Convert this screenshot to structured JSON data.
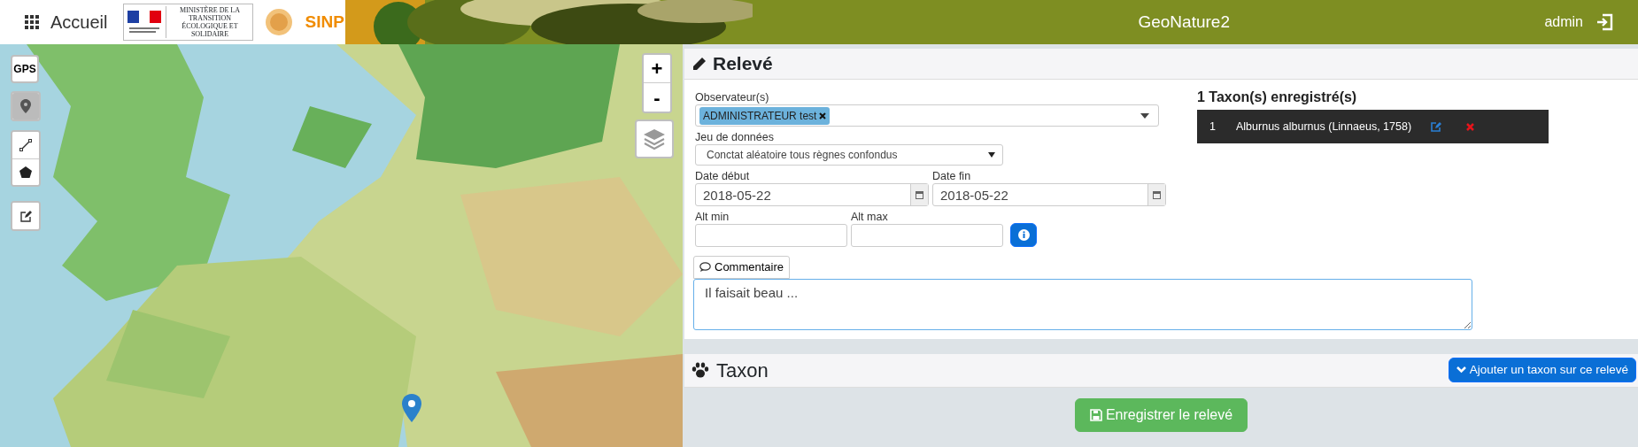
{
  "header": {
    "menu_label": "Accueil",
    "ministry_logo": "MINISTÈRE DE LA TRANSITION ÉCOLOGIQUE ET SOLIDAIRE",
    "sinp_logo": "SINP",
    "title": "GeoNature2",
    "user": "admin"
  },
  "map": {
    "gps_label": "GPS",
    "zoom_in": "+",
    "zoom_out": "-",
    "tools": [
      {
        "kind": "marker",
        "selected": true
      },
      {
        "kind": "line",
        "selected": false
      },
      {
        "kind": "polygon",
        "selected": false
      },
      {
        "kind": "edit",
        "selected": false
      }
    ]
  },
  "releve": {
    "title": "Relevé",
    "observers": {
      "label": "Observateur(s)",
      "tags": [
        "ADMINISTRATEUR test"
      ]
    },
    "dataset": {
      "label": "Jeu de données",
      "value": "Conctat aléatoire tous règnes confondus"
    },
    "date_start": {
      "label": "Date début",
      "value": "2018-05-22"
    },
    "date_end": {
      "label": "Date fin",
      "value": "2018-05-22"
    },
    "alt_min": {
      "label": "Alt min"
    },
    "alt_max": {
      "label": "Alt max"
    },
    "comment_button": "Commentaire",
    "comment": "Il faisait beau ..."
  },
  "taxa_list": {
    "title": "1 Taxon(s) enregistré(s)",
    "rows": [
      {
        "index": "1",
        "name": "Alburnus alburnus (Linnaeus, 1758)"
      }
    ]
  },
  "taxon": {
    "title": "Taxon",
    "add_button": "Ajouter un taxon sur ce relevé"
  },
  "save_button": "Enregistrer le relevé"
}
